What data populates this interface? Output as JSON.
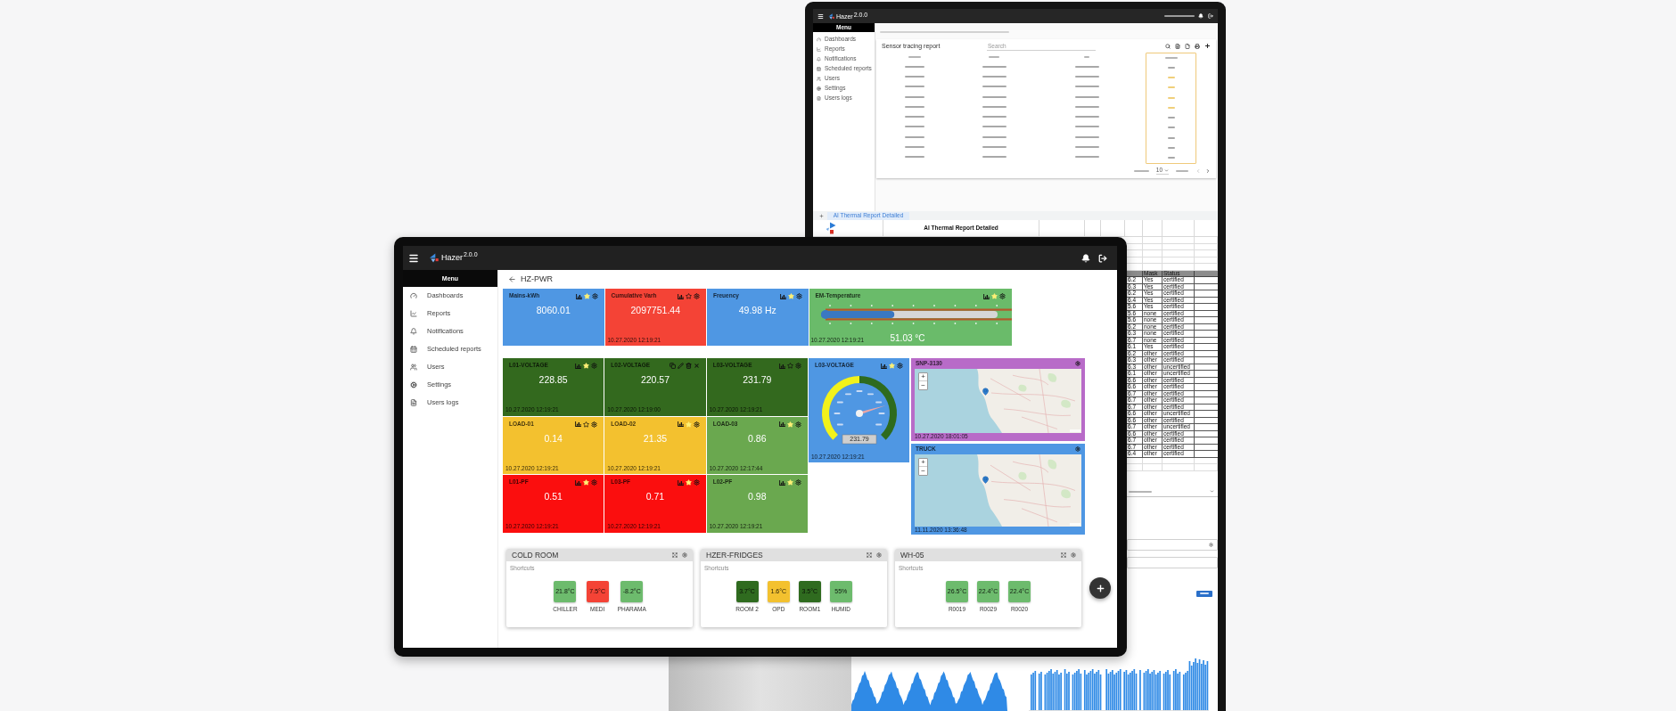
{
  "back_screen": {
    "app_bar": {
      "logo_text": "Hazer",
      "version": "2.0.0"
    },
    "sidebar": {
      "title": "Menu",
      "items": [
        {
          "label": "Dashboards"
        },
        {
          "label": "Reports"
        },
        {
          "label": "Notifications"
        },
        {
          "label": "Scheduled reports"
        },
        {
          "label": "Users"
        },
        {
          "label": "Settings"
        },
        {
          "label": "Users logs"
        }
      ]
    },
    "report": {
      "title": "Sensor tracing report",
      "search": {
        "placeholder": "Search"
      },
      "rows": [
        {
          "flagged": false
        },
        {
          "flagged": true
        },
        {
          "flagged": true
        },
        {
          "flagged": true
        },
        {
          "flagged": true
        },
        {
          "flagged": false
        },
        {
          "flagged": false
        },
        {
          "flagged": false
        },
        {
          "flagged": false
        },
        {
          "flagged": false
        }
      ],
      "rows_per_page": "10"
    },
    "spreadsheet": {
      "tab": "AI Thermal Report Detailed",
      "title": "AI Thermal Report Detailed",
      "columns": [
        "",
        "Mask",
        "Status"
      ],
      "rows": [
        {
          "cells": [
            "6.2",
            "Yes",
            "certified"
          ]
        },
        {
          "cells": [
            "6.3",
            "Yes",
            "certified"
          ]
        },
        {
          "cells": [
            "6.2",
            "Yes",
            "certified"
          ]
        },
        {
          "cells": [
            "6.4",
            "Yes",
            "certified"
          ]
        },
        {
          "cells": [
            "5.6",
            "Yes",
            "certified"
          ]
        },
        {
          "cells": [
            "5.6",
            "none",
            "certified"
          ]
        },
        {
          "cells": [
            "5.6",
            "none",
            "certified"
          ]
        },
        {
          "cells": [
            "6.2",
            "none",
            "certified"
          ]
        },
        {
          "cells": [
            "6.3",
            "none",
            "certified"
          ]
        },
        {
          "cells": [
            "6.7",
            "none",
            "certified"
          ]
        },
        {
          "cells": [
            "6.1",
            "Yes",
            "certified"
          ]
        },
        {
          "cells": [
            "6.2",
            "other",
            "certified"
          ]
        },
        {
          "cells": [
            "6.3",
            "other",
            "certified"
          ]
        },
        {
          "cells": [
            "6.3",
            "other",
            "uncertified"
          ]
        },
        {
          "cells": [
            "6.1",
            "other",
            "uncertified"
          ]
        },
        {
          "cells": [
            "6.6",
            "other",
            "certified"
          ]
        },
        {
          "cells": [
            "6.6",
            "other",
            "certified"
          ]
        },
        {
          "cells": [
            "6.7",
            "other",
            "certified"
          ]
        },
        {
          "cells": [
            "6.7",
            "other",
            "certified"
          ]
        },
        {
          "cells": [
            "6.7",
            "other",
            "certified"
          ]
        },
        {
          "cells": [
            "6.6",
            "other",
            "uncertified"
          ]
        },
        {
          "cells": [
            "6.6",
            "other",
            "certified"
          ]
        },
        {
          "cells": [
            "6.7",
            "other",
            "uncertified"
          ]
        },
        {
          "cells": [
            "6.6",
            "other",
            "certified"
          ]
        },
        {
          "cells": [
            "6.7",
            "other",
            "certified"
          ]
        },
        {
          "cells": [
            "6.7",
            "other",
            "certified"
          ]
        },
        {
          "cells": [
            "6.4",
            "other",
            "certified"
          ]
        }
      ]
    }
  },
  "front_screen": {
    "app_bar": {
      "logo_text": "Hazer",
      "version": "2.0.0"
    },
    "sidebar": {
      "title": "Menu",
      "items": [
        {
          "label": "Dashboards"
        },
        {
          "label": "Reports"
        },
        {
          "label": "Notifications"
        },
        {
          "label": "Scheduled reports"
        },
        {
          "label": "Users"
        },
        {
          "label": "Settings"
        },
        {
          "label": "Users logs"
        }
      ]
    },
    "page_title": "HZ-PWR",
    "top_tiles": [
      {
        "kind": "value",
        "title": "Mains-kWh",
        "value": "8060.01",
        "color": "#4f97e3",
        "favorite": true,
        "editing": false
      },
      {
        "kind": "value",
        "title": "Cumulative Varh",
        "value": "2097751.44",
        "timestamp": "10.27.2020 12:19:21",
        "color": "#f44336",
        "favorite": false,
        "editing": false
      },
      {
        "kind": "value",
        "title": "Freuency",
        "value": "49.98 Hz",
        "color": "#4f97e3",
        "favorite": true,
        "editing": false
      },
      {
        "kind": "thermometer",
        "title": "EM-Temperature",
        "level": 0.4,
        "value": "51.03 °C",
        "timestamp": "10.27.2020 12:19:21",
        "color": "#6abb6a",
        "favorite": true,
        "editing": false
      }
    ],
    "grid_tiles": [
      {
        "title": "L01-VOLTAGE",
        "value": "228.85",
        "timestamp": "10.27.2020 12:19:21",
        "color": "#33691e",
        "favorite": true,
        "editing": false
      },
      {
        "title": "L02-VOLTAGE",
        "value": "220.57",
        "timestamp": "10.27.2020 12:19:00",
        "color": "#33691e",
        "editing": true
      },
      {
        "title": "L03-VOLTAGE",
        "value": "231.79",
        "timestamp": "10.27.2020 12:19:21",
        "color": "#33691e",
        "favorite": false,
        "editing": false
      },
      {
        "title": "LOAD-01",
        "value": "0.14",
        "timestamp": "10.27.2020 12:19:21",
        "color": "#f3c12f",
        "favorite": false,
        "editing": false
      },
      {
        "title": "LOAD-02",
        "value": "21.35",
        "timestamp": "10.27.2020 12:19:21",
        "color": "#f3c12f",
        "favorite": true,
        "editing": false
      },
      {
        "title": "LOAD-03",
        "value": "0.86",
        "timestamp": "10.27.2020 12:17:44",
        "color": "#6aa84f",
        "favorite": true,
        "editing": false
      },
      {
        "title": "L01-PF",
        "value": "0.51",
        "timestamp": "10.27.2020 12:19:21",
        "color": "#fb0e0e",
        "favorite": true,
        "editing": false
      },
      {
        "title": "L03-PF",
        "value": "0.71",
        "timestamp": "10.27.2020 12:19:21",
        "color": "#fb0e0e",
        "favorite": true,
        "editing": false
      },
      {
        "title": "L02-PF",
        "value": "0.98",
        "timestamp": "10.27.2020 12:19:21",
        "color": "#6aa84f",
        "favorite": true,
        "editing": false
      }
    ],
    "gauge_tile": {
      "title": "L03-VOLTAGE",
      "level": 0.77,
      "reading": "231.79",
      "timestamp": "10.27.2020 12:19:21",
      "color": "#4f97e3",
      "favorite": true
    },
    "map_tiles": [
      {
        "title": "SNP-3130",
        "zoom_in": "+",
        "zoom_out": "−",
        "timestamp": "10.27.2020 18:01:05",
        "color": "#b86bc8"
      },
      {
        "title": "TRUCK",
        "zoom_in": "+",
        "zoom_out": "−",
        "timestamp": "11.11.2020 13:36:48",
        "color": "#4f97e3"
      }
    ],
    "cards": [
      {
        "title": "COLD ROOM",
        "section": "Shortcuts",
        "shortcuts": [
          {
            "value": "21.8°C",
            "label": "CHILLER",
            "color": "#6dbb6d"
          },
          {
            "value": "7.5°C",
            "label": "MEDI",
            "color": "#f44336"
          },
          {
            "value": "-8.2°C",
            "label": "PHARAMA",
            "color": "#6dbb6d"
          }
        ]
      },
      {
        "title": "HZER-FRIDGES",
        "section": "Shortcuts",
        "shortcuts": [
          {
            "value": "3.7°C",
            "label": "ROOM 2",
            "color": "#2f6b1f"
          },
          {
            "value": "1.6°C",
            "label": "OPD",
            "color": "#f3c12f"
          },
          {
            "value": "3.5°C",
            "label": "ROOM1",
            "color": "#2f6b1f"
          },
          {
            "value": "55%",
            "label": "HUMID",
            "color": "#6dbb6d"
          }
        ]
      },
      {
        "title": "WH-05",
        "section": "Shortcuts",
        "shortcuts": [
          {
            "value": "26.5°C",
            "label": "R0019",
            "color": "#6dbb6d"
          },
          {
            "value": "22.4°C",
            "label": "R0029",
            "color": "#6dbb6d"
          },
          {
            "value": "22.4°C",
            "label": "R0020",
            "color": "#6dbb6d"
          }
        ]
      }
    ]
  }
}
